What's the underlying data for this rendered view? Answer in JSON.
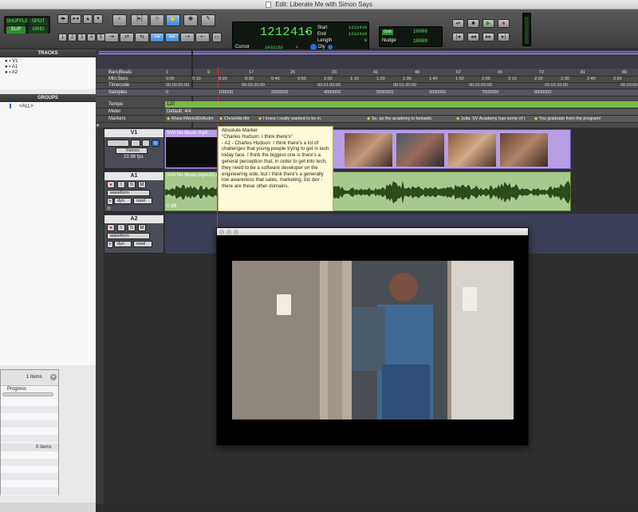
{
  "window": {
    "title": "Edit: Liberate Me with Simon Says"
  },
  "toolbar": {
    "modes": [
      "SHUFFLE",
      "SPOT",
      "SLIP",
      "GRID"
    ],
    "zoom_presets": [
      "1",
      "2",
      "3",
      "4",
      "5"
    ],
    "counter": {
      "main": "1212416",
      "cursor_label": "Cursor",
      "cursor_value": "1032152",
      "dly_label": "Dly"
    },
    "selection": {
      "start_label": "Start",
      "end_label": "End",
      "length_label": "Length",
      "start": "1212416",
      "end": "1212416",
      "length": "0"
    },
    "grid": {
      "label": "Grid",
      "value": "10000"
    },
    "nudge": {
      "label": "Nudge",
      "value": "10000"
    }
  },
  "left_panel": {
    "tracks_header": "TRACKS",
    "tracks": [
      "V1",
      "A1",
      "A2"
    ],
    "groups_header": "GROUPS",
    "groups": [
      "<ALL>"
    ]
  },
  "rulers": {
    "rows": [
      "Bars|Beats",
      "Min:Secs",
      "Timecode",
      "Samples",
      "Tempo",
      "Meter",
      "Markers"
    ],
    "bars": [
      "1",
      "9",
      "17",
      "25",
      "33",
      "41",
      "49",
      "57",
      "65",
      "72",
      "81",
      "89"
    ],
    "minsecs": [
      "0:00",
      "0:10",
      "0:20",
      "0:30",
      "0:40",
      "0:50",
      "1:00",
      "1:10",
      "1:20",
      "1:30",
      "1:40",
      "1:50",
      "2:00",
      "2:10",
      "2:20",
      "2:30",
      "2:40",
      "2:50",
      "3:00"
    ],
    "timecode": [
      "00:00:00:00",
      "00:00:30:00",
      "00:01:00:00",
      "00:01:30:00",
      "00:02:00:00",
      "00:02:30:00",
      "00:03:00:00"
    ],
    "samples": [
      "0",
      "100000",
      "2000000",
      "4000000",
      "5000000",
      "6000000",
      "7000000",
      "8000000"
    ],
    "tempo_value": "120",
    "meter_value": "Default: 4/4",
    "markers": [
      "Rhea:#WeirdSVAcdm",
      "ChrisHde:ithr",
      "I knew I really wanted to be in",
      "So, as the academy is fantastic",
      "Julia: SV Academy has some of t",
      "You graduate from the program!"
    ]
  },
  "tracks": {
    "v1": {
      "name": "V1",
      "format": "frames",
      "fps": "23.98 fps",
      "clip": "SVA No Music.mp4"
    },
    "a1": {
      "name": "A1",
      "view": "waveform",
      "automation": "dyn",
      "mode": "read",
      "clip": "SVA No Music.mp4-01.A1",
      "gain": "0 dB"
    },
    "a2": {
      "name": "A2",
      "view": "waveform",
      "automation": "dyn",
      "mode": "read"
    }
  },
  "tooltip": {
    "title": "Absolute Marker",
    "quote": "\"Charles Hudson: I think there's\"",
    "body": "- A2 - Charles Hudson: I think there's a lot of challenges that young people trying to get in tech today face. I think the biggest one is there's a general perception that, in order to get into tech, they need to be a software developer on the engineering side, but I think there's a generally low awareness that sales, marketing, biz dev - there are these other domains."
  },
  "progress_window": {
    "count_top": "1 Items",
    "column": "Progress",
    "count_bottom": "0 Items"
  }
}
